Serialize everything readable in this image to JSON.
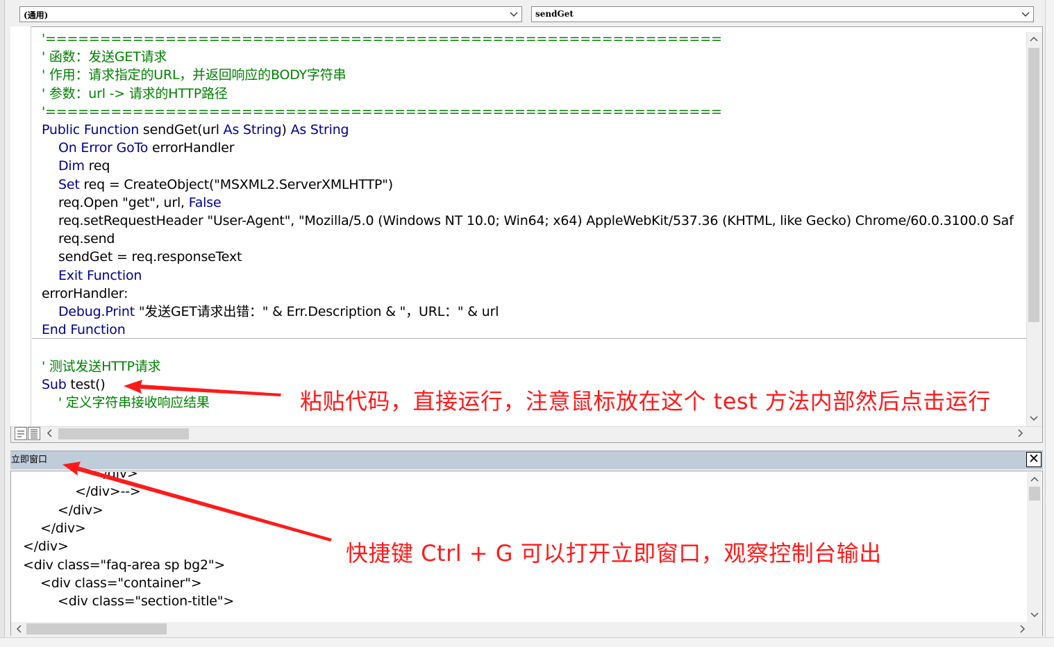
{
  "header": {
    "object_combo_value": "(通用)",
    "procedure_combo_value": "sendGet"
  },
  "code": {
    "lines": [
      {
        "indent": false,
        "parts": [
          {
            "t": "'==============================================================",
            "c": "cm"
          }
        ]
      },
      {
        "indent": false,
        "parts": [
          {
            "t": "' 函数：发送GET请求",
            "c": "cm"
          }
        ]
      },
      {
        "indent": false,
        "parts": [
          {
            "t": "' 作用：请求指定的URL，并返回响应的BODY字符串",
            "c": "cm"
          }
        ]
      },
      {
        "indent": false,
        "parts": [
          {
            "t": "' 参数：url -> 请求的HTTP路径",
            "c": "cm"
          }
        ]
      },
      {
        "indent": false,
        "parts": [
          {
            "t": "'==============================================================",
            "c": "cm"
          }
        ]
      },
      {
        "indent": false,
        "parts": [
          {
            "t": "Public Function",
            "c": "kw"
          },
          {
            "t": " sendGet(url ",
            "c": ""
          },
          {
            "t": "As String",
            "c": "kw"
          },
          {
            "t": ") ",
            "c": ""
          },
          {
            "t": "As String",
            "c": "kw"
          }
        ]
      },
      {
        "indent": true,
        "parts": [
          {
            "t": "On Error GoTo",
            "c": "kw"
          },
          {
            "t": " errorHandler",
            "c": ""
          }
        ]
      },
      {
        "indent": true,
        "parts": [
          {
            "t": "Dim",
            "c": "kw"
          },
          {
            "t": " req",
            "c": ""
          }
        ]
      },
      {
        "indent": true,
        "parts": [
          {
            "t": "Set",
            "c": "kw"
          },
          {
            "t": " req = CreateObject(\"MSXML2.ServerXMLHTTP\")",
            "c": ""
          }
        ]
      },
      {
        "indent": true,
        "parts": [
          {
            "t": "req.Open \"get\", url, ",
            "c": ""
          },
          {
            "t": "False",
            "c": "kw"
          }
        ]
      },
      {
        "indent": true,
        "parts": [
          {
            "t": "req.setRequestHeader \"User-Agent\", \"Mozilla/5.0 (Windows NT 10.0; Win64; x64) AppleWebKit/537.36 (KHTML, like Gecko) Chrome/60.0.3100.0 Saf",
            "c": ""
          }
        ]
      },
      {
        "indent": true,
        "parts": [
          {
            "t": "req.send",
            "c": ""
          }
        ]
      },
      {
        "indent": true,
        "parts": [
          {
            "t": "sendGet = req.responseText",
            "c": ""
          }
        ]
      },
      {
        "indent": true,
        "parts": [
          {
            "t": "Exit Function",
            "c": "kw"
          }
        ]
      },
      {
        "indent": false,
        "parts": [
          {
            "t": "errorHandler:",
            "c": ""
          }
        ]
      },
      {
        "indent": true,
        "parts": [
          {
            "t": "Debug.Print",
            "c": "kw"
          },
          {
            "t": " \"发送GET请求出错：\" & Err.Description & \"，URL：\" & url",
            "c": ""
          }
        ]
      },
      {
        "indent": false,
        "parts": [
          {
            "t": "End Function",
            "c": "kw"
          }
        ]
      },
      {
        "indent": false,
        "parts": [
          {
            "t": "",
            "c": ""
          }
        ]
      },
      {
        "indent": false,
        "parts": [
          {
            "t": "' 测试发送HTTP请求",
            "c": "cm"
          }
        ]
      },
      {
        "indent": false,
        "parts": [
          {
            "t": "Sub",
            "c": "kw"
          },
          {
            "t": " test()",
            "c": ""
          }
        ]
      },
      {
        "indent": true,
        "parts": [
          {
            "t": "' 定义字符串接收响应结果",
            "c": "cm"
          }
        ]
      }
    ]
  },
  "immediate": {
    "title": "立即窗口",
    "close_label": "✕",
    "lines": [
      {
        "indent": 4,
        "text": "</div>"
      },
      {
        "indent": 3,
        "text": "</div>-->"
      },
      {
        "indent": 2,
        "text": "</div>"
      },
      {
        "indent": 1,
        "text": "</div>"
      },
      {
        "indent": 0,
        "text": "</div>"
      },
      {
        "indent": 0,
        "text": "<div class=\"faq-area sp bg2\">"
      },
      {
        "indent": 1,
        "text": "<div class=\"container\">"
      },
      {
        "indent": 2,
        "text": "<div class=\"section-title\">"
      }
    ]
  },
  "annotations": {
    "paste_note": "粘贴代码，直接运行，注意鼠标放在这个 test 方法内部然后点击运行",
    "shortcut_note": "快捷键 Ctrl + G 可以打开立即窗口，观察控制台输出"
  },
  "icons": {
    "dropdown": "chevron-down-icon",
    "scroll_up": "▲",
    "scroll_down": "▼",
    "scroll_left": "◀",
    "scroll_right": "▶"
  },
  "colors": {
    "keyword": "#00008b",
    "comment": "#008000",
    "annotation": "#ff1a1a",
    "immediate_title_bar": "#bfcddb"
  }
}
